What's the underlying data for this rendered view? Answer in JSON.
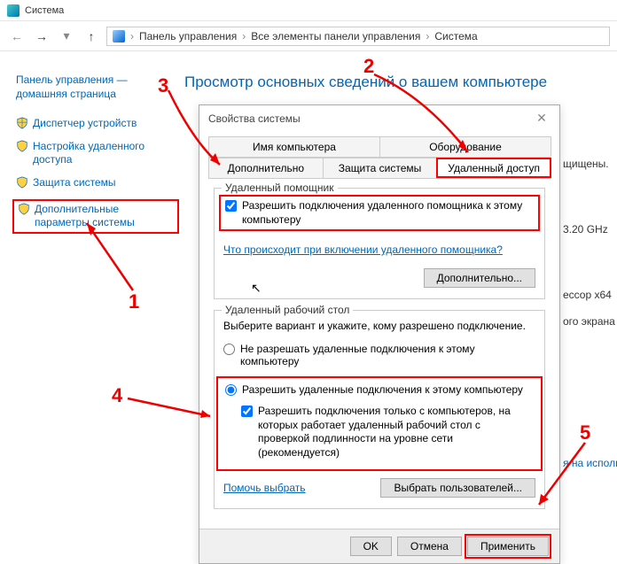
{
  "window": {
    "title": "Система"
  },
  "breadcrumb": {
    "item1": "Панель управления",
    "item2": "Все элементы панели управления",
    "item3": "Система"
  },
  "sidebar": {
    "home": "Панель управления — домашняя страница",
    "items": [
      "Диспетчер устройств",
      "Настройка удаленного доступа",
      "Защита системы",
      "Дополнительные параметры системы"
    ]
  },
  "content": {
    "heading": "Просмотр основных сведений о вашем компьютере",
    "bg_lines": [
      "щищены.",
      "3.20 GHz",
      "ессор x64",
      "ого экрана",
      "я на использов"
    ]
  },
  "dialog": {
    "title": "Свойства системы",
    "tabs_row1": [
      "Имя компьютера",
      "Оборудование"
    ],
    "tabs_row2": [
      "Дополнительно",
      "Защита системы",
      "Удаленный доступ"
    ],
    "ra_group": "Удаленный помощник",
    "ra_checkbox": "Разрешить подключения удаленного помощника к этому компьютеру",
    "ra_link": "Что происходит при включении удаленного помощника?",
    "ra_btn": "Дополнительно...",
    "rd_group": "Удаленный рабочий стол",
    "rd_text": "Выберите вариант и укажите, кому разрешено подключение.",
    "rd_radio1": "Не разрешать удаленные подключения к этому компьютеру",
    "rd_radio2": "Разрешить удаленные подключения к этому компьютеру",
    "rd_sub_checkbox": "Разрешить подключения только с компьютеров, на которых работает удаленный рабочий стол с проверкой подлинности на уровне сети (рекомендуется)",
    "rd_help": "Помочь выбрать",
    "rd_users_btn": "Выбрать пользователей...",
    "ok": "OK",
    "cancel": "Отмена",
    "apply": "Применить"
  },
  "annotations": {
    "n1": "1",
    "n2": "2",
    "n3": "3",
    "n4": "4",
    "n5": "5"
  }
}
